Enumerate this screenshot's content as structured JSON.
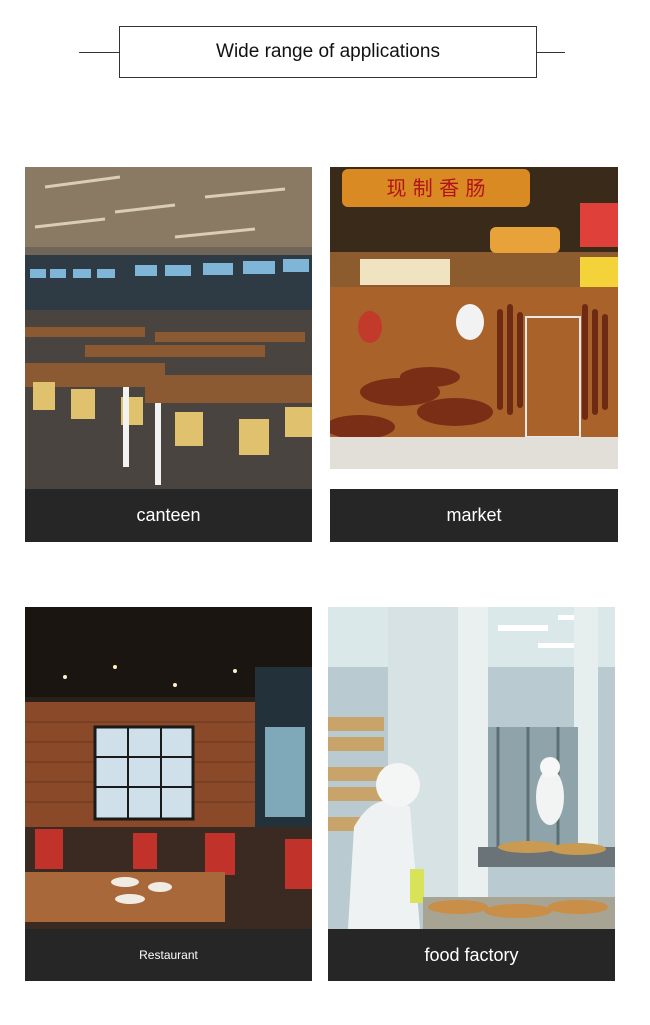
{
  "header": {
    "title": "Wide range of applications"
  },
  "cards": [
    {
      "caption": "canteen"
    },
    {
      "caption": "market",
      "sign": "现 制 香 肠"
    },
    {
      "caption": "Restaurant"
    },
    {
      "caption": "food factory"
    }
  ]
}
